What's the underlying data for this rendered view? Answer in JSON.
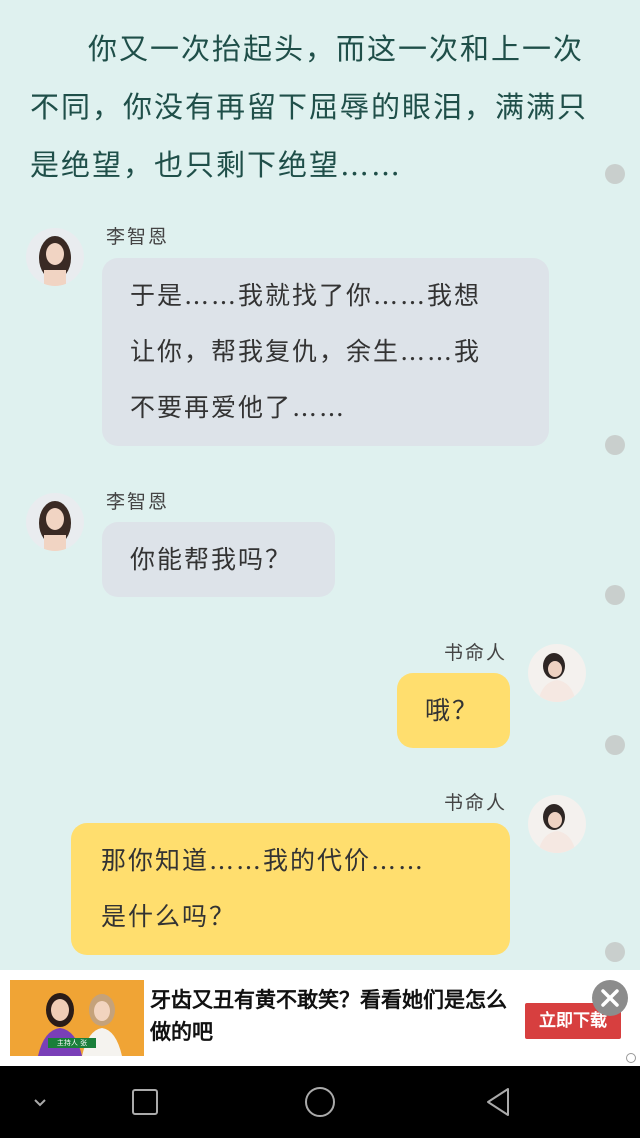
{
  "story": {
    "text": "你又一次抬起头，而这一次和上一次不同，你没有再留下屈辱的眼泪，满满只是绝望，也只剩下绝望……"
  },
  "messages": [
    {
      "sender": "李智恩",
      "side": "left",
      "lines": [
        "于是……我就找了你……我想",
        "让你，帮我复仇，余生……我",
        "不要再爱他了……"
      ]
    },
    {
      "sender": "李智恩",
      "side": "left",
      "lines": [
        "你能帮我吗？"
      ]
    },
    {
      "sender": "书命人",
      "side": "right",
      "lines": [
        "哦？"
      ]
    },
    {
      "sender": "书命人",
      "side": "right",
      "lines": [
        "那你知道……我的代价……",
        "是什么吗？"
      ]
    }
  ],
  "ad": {
    "headline": "牙齿又丑有黄不敢笑？看看她们是怎么做的吧",
    "cta_label": "立即下载",
    "thumb_caption": "主持人 张"
  },
  "colors": {
    "background": "#dff1ef",
    "left_bubble": "#dde3e9",
    "right_bubble": "#ffde6e",
    "cta": "#d73f3f"
  },
  "icons": {
    "nav": [
      "chevron-down-icon",
      "recent-apps-icon",
      "home-icon",
      "back-icon"
    ],
    "ad_close": "close-icon"
  }
}
